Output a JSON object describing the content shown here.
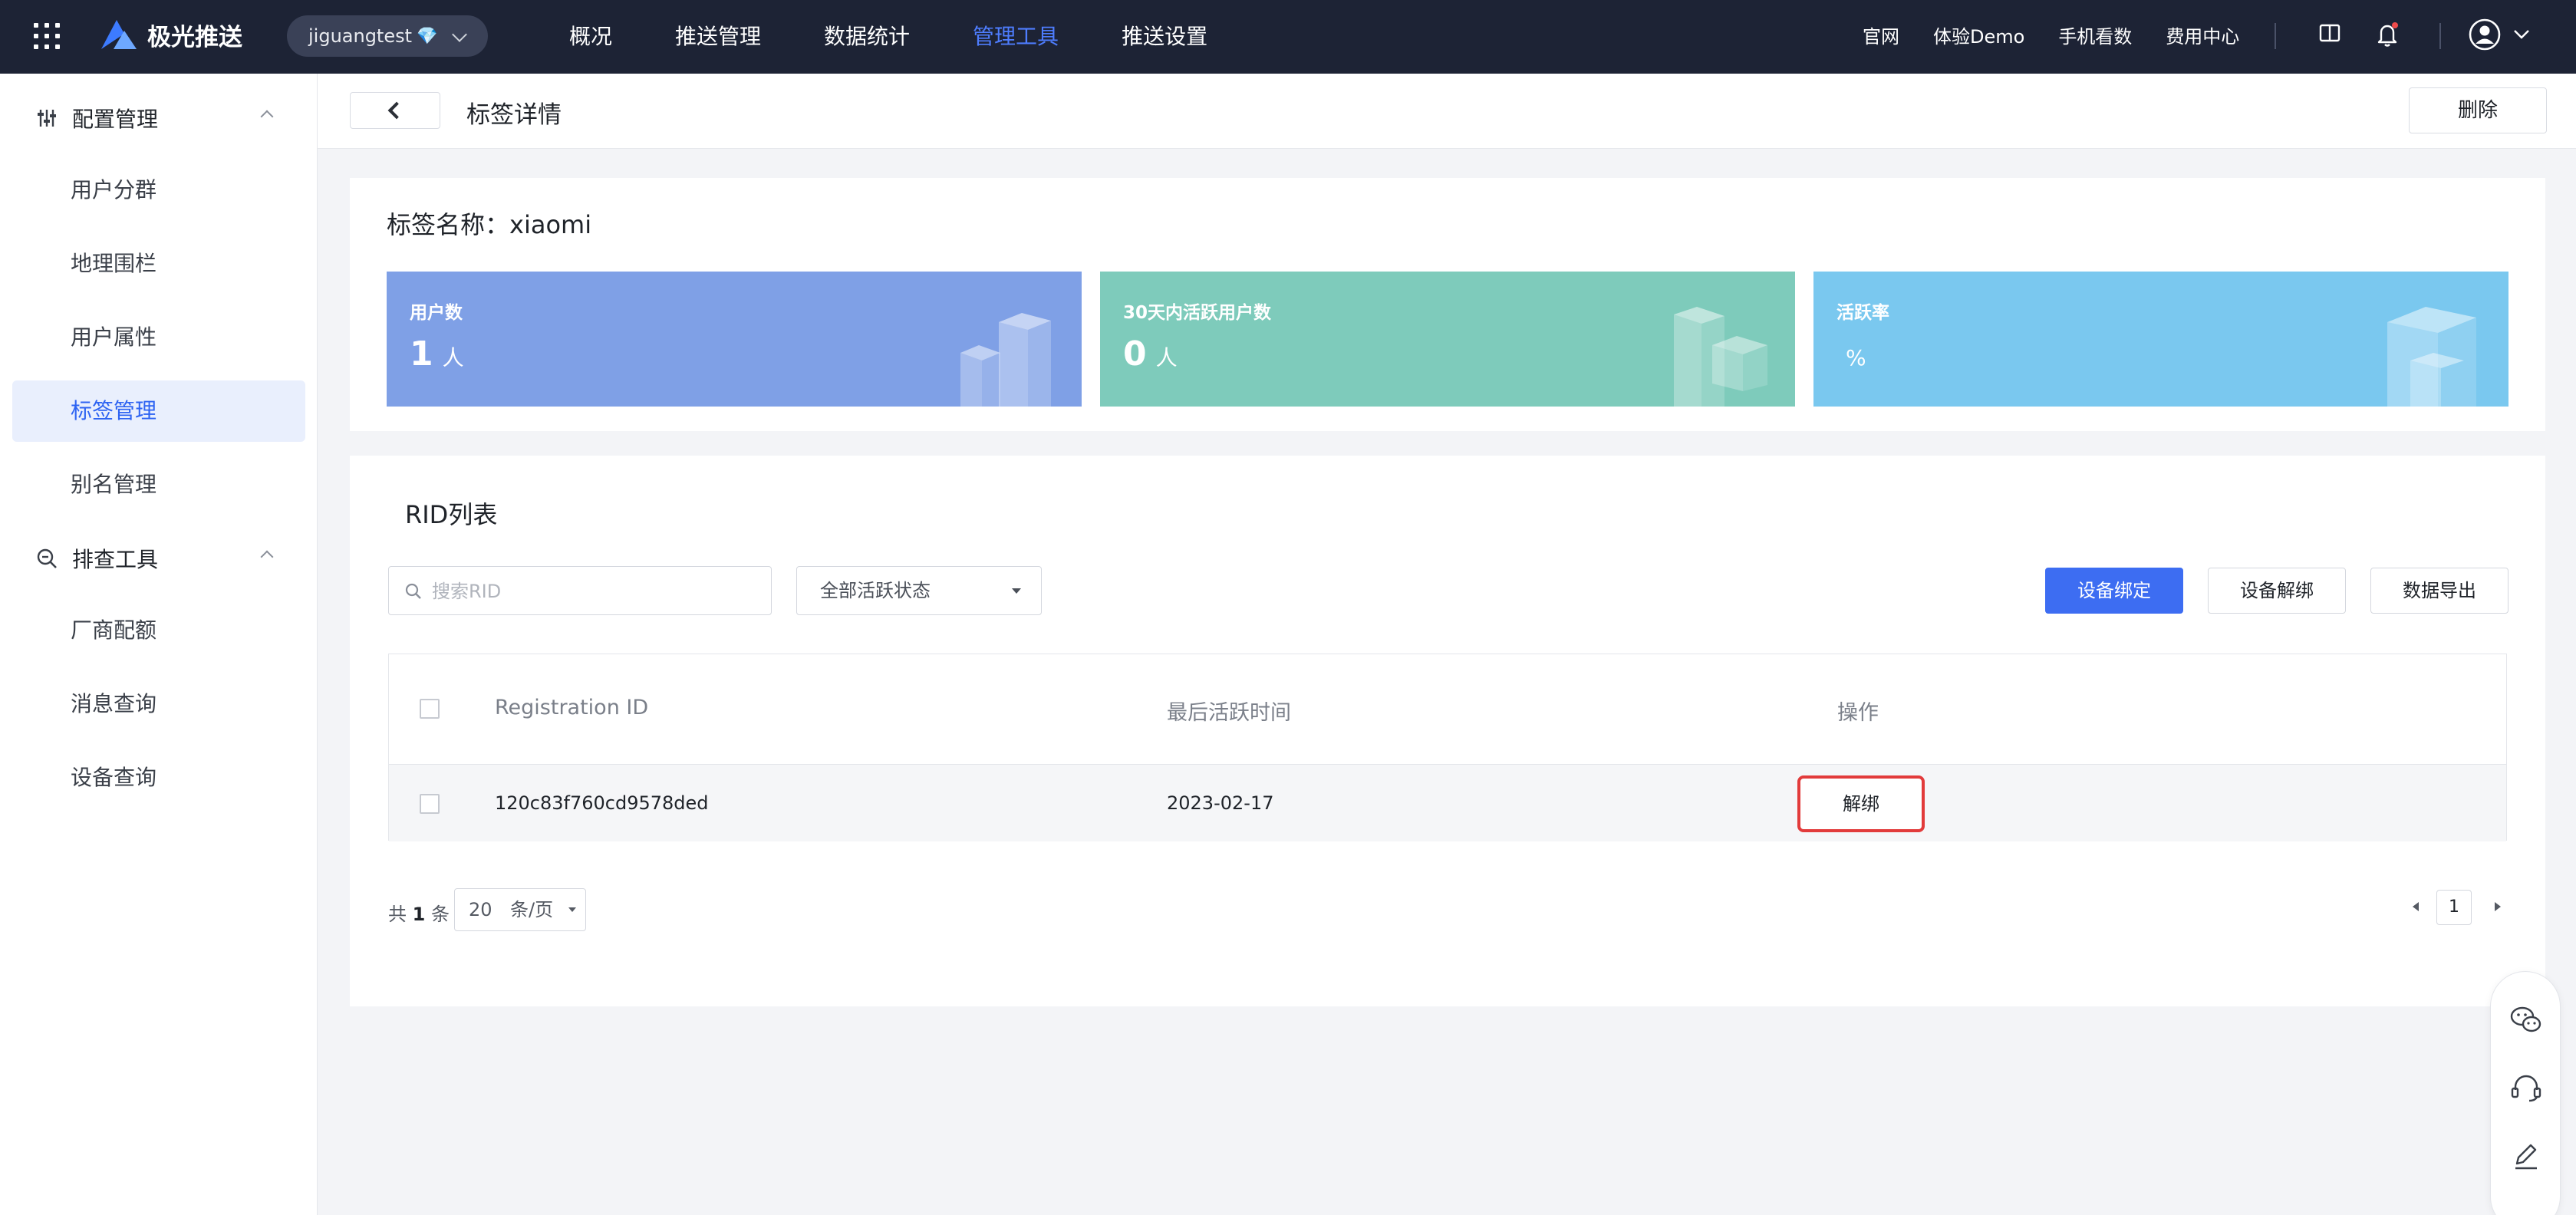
{
  "topbar": {
    "brand": "极光推送",
    "app_name": "jiguangtest",
    "app_badge": "💎",
    "nav": [
      "概况",
      "推送管理",
      "数据统计",
      "管理工具",
      "推送设置"
    ],
    "active_nav": "管理工具",
    "links": [
      "官网",
      "体验Demo",
      "手机看数",
      "费用中心"
    ]
  },
  "sidebar": {
    "groups": [
      {
        "label": "配置管理",
        "icon": "sliders-icon",
        "items": [
          "用户分群",
          "地理围栏",
          "用户属性",
          "标签管理",
          "别名管理"
        ]
      },
      {
        "label": "排查工具",
        "icon": "search-zoom-icon",
        "items": [
          "厂商配额",
          "消息查询",
          "设备查询"
        ]
      }
    ],
    "active_item": "标签管理"
  },
  "header": {
    "title": "标签详情",
    "delete_label": "删除"
  },
  "summary": {
    "tag_label": "标签名称：xiaomi",
    "stats": [
      {
        "label": "用户数",
        "value": "1",
        "unit": "人",
        "color": "#7fa0e6"
      },
      {
        "label": "30天内活跃用户数",
        "value": "0",
        "unit": "人",
        "color": "#7ecbbb"
      },
      {
        "label": "活跃率",
        "value": "",
        "unit": "%",
        "color": "#7ac8ef"
      }
    ]
  },
  "rid_list": {
    "title": "RID列表",
    "search_placeholder": "搜索RID",
    "status_filter": "全部活跃状态",
    "buttons": {
      "bind": "设备绑定",
      "unbind": "设备解绑",
      "export": "数据导出"
    },
    "columns": [
      "Registration ID",
      "最后活跃时间",
      "操作"
    ],
    "rows": [
      {
        "rid": "120c83f760cd9578ded",
        "last_active": "2023-02-17",
        "action": "解绑"
      }
    ],
    "pager": {
      "total_prefix": "共",
      "total": "1",
      "total_suffix": "条",
      "page_size": "20",
      "page_size_unit": "条/页",
      "current_page": "1"
    }
  },
  "colors": {
    "topbar_bg": "#1d2335",
    "accent": "#3d6df2",
    "active_nav": "#4e7dff",
    "highlight_border": "#e23b3b"
  }
}
